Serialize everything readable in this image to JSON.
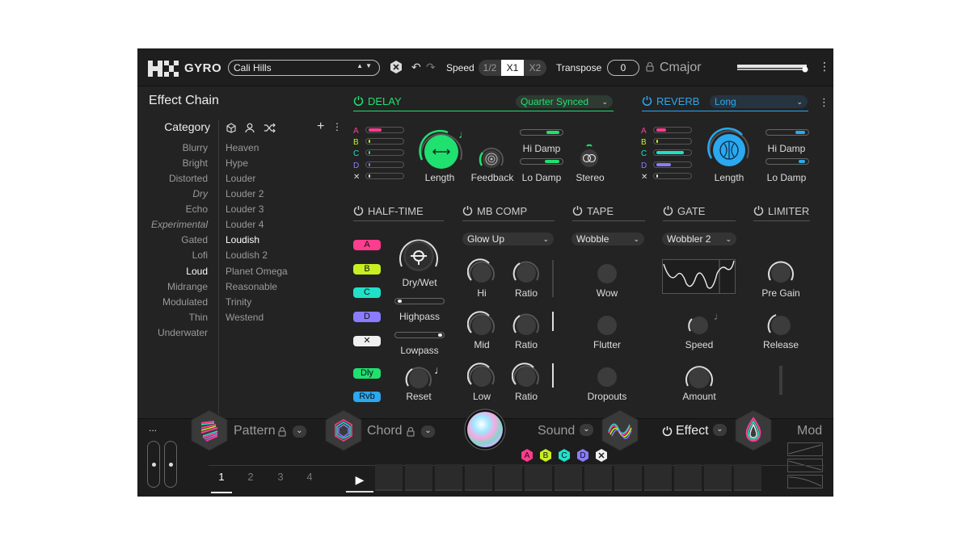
{
  "topbar": {
    "app_name": "GYRO",
    "preset": "Cali Hills",
    "speed_label": "Speed",
    "speed_options": [
      "1/2",
      "X1",
      "X2"
    ],
    "speed_selected": "X1",
    "transpose_label": "Transpose",
    "transpose_value": "0",
    "key": "Cmajor"
  },
  "effect_chain": {
    "title": "Effect Chain",
    "category_title": "Category",
    "categories": [
      {
        "label": "Blurry",
        "style": "normal"
      },
      {
        "label": "Bright",
        "style": "normal"
      },
      {
        "label": "Distorted",
        "style": "normal"
      },
      {
        "label": "Dry",
        "style": "italic"
      },
      {
        "label": "Echo",
        "style": "normal"
      },
      {
        "label": "Experimental",
        "style": "italic"
      },
      {
        "label": "Gated",
        "style": "normal"
      },
      {
        "label": "Lofi",
        "style": "normal"
      },
      {
        "label": "Loud",
        "style": "selected"
      },
      {
        "label": "Midrange",
        "style": "normal"
      },
      {
        "label": "Modulated",
        "style": "normal"
      },
      {
        "label": "Thin",
        "style": "normal"
      },
      {
        "label": "Underwater",
        "style": "normal"
      }
    ],
    "presets": [
      "Heaven",
      "Hype",
      "Louder",
      "Louder 2",
      "Louder 3",
      "Louder 4",
      "Loudish",
      "Loudish 2",
      "Planet Omega",
      "Reasonable",
      "Trinity",
      "Westend"
    ],
    "selected_preset": "Loudish"
  },
  "delay": {
    "title": "DELAY",
    "mode": "Quarter Synced",
    "lanes": [
      "A",
      "B",
      "C",
      "D"
    ],
    "length_label": "Length",
    "feedback_label": "Feedback",
    "hi_damp_label": "Hi Damp",
    "lo_damp_label": "Lo Damp",
    "stereo_label": "Stereo"
  },
  "reverb": {
    "title": "REVERB",
    "mode": "Long",
    "lanes": [
      "A",
      "B",
      "C",
      "D"
    ],
    "length_label": "Length",
    "hi_damp_label": "Hi Damp",
    "lo_damp_label": "Lo Damp"
  },
  "halftime": {
    "title": "HALF-TIME",
    "lane_buttons": [
      "A",
      "B",
      "C",
      "D"
    ],
    "dly_label": "Dly",
    "rvb_label": "Rvb",
    "drywet_label": "Dry/Wet",
    "highpass_label": "Highpass",
    "lowpass_label": "Lowpass",
    "reset_label": "Reset"
  },
  "mbcomp": {
    "title": "MB COMP",
    "mode": "Glow Up",
    "knobs": [
      "Hi",
      "Ratio",
      "Mid",
      "Ratio",
      "Low",
      "Ratio"
    ]
  },
  "tape": {
    "title": "TAPE",
    "mode": "Wobble",
    "knobs": [
      "Wow",
      "Flutter",
      "Dropouts"
    ]
  },
  "gate": {
    "title": "GATE",
    "mode": "Wobbler 2",
    "speed_label": "Speed",
    "amount_label": "Amount"
  },
  "limiter": {
    "title": "LIMITER",
    "pregain_label": "Pre Gain",
    "release_label": "Release"
  },
  "bottom": {
    "more": "...",
    "pattern_label": "Pattern",
    "chord_label": "Chord",
    "sound_label": "Sound",
    "effect_label": "Effect",
    "mod_label": "Mod",
    "lane_badges": [
      "A",
      "B",
      "C",
      "D"
    ],
    "pattern_tabs": [
      "1",
      "2",
      "3",
      "4"
    ],
    "selected_tab": "1"
  },
  "colors": {
    "delay": "#20e070",
    "reverb": "#2aa8f0",
    "lane_a": "#ff3d8e",
    "lane_b": "#c8f020",
    "lane_c": "#20e0c8",
    "lane_d": "#8a7cff"
  }
}
